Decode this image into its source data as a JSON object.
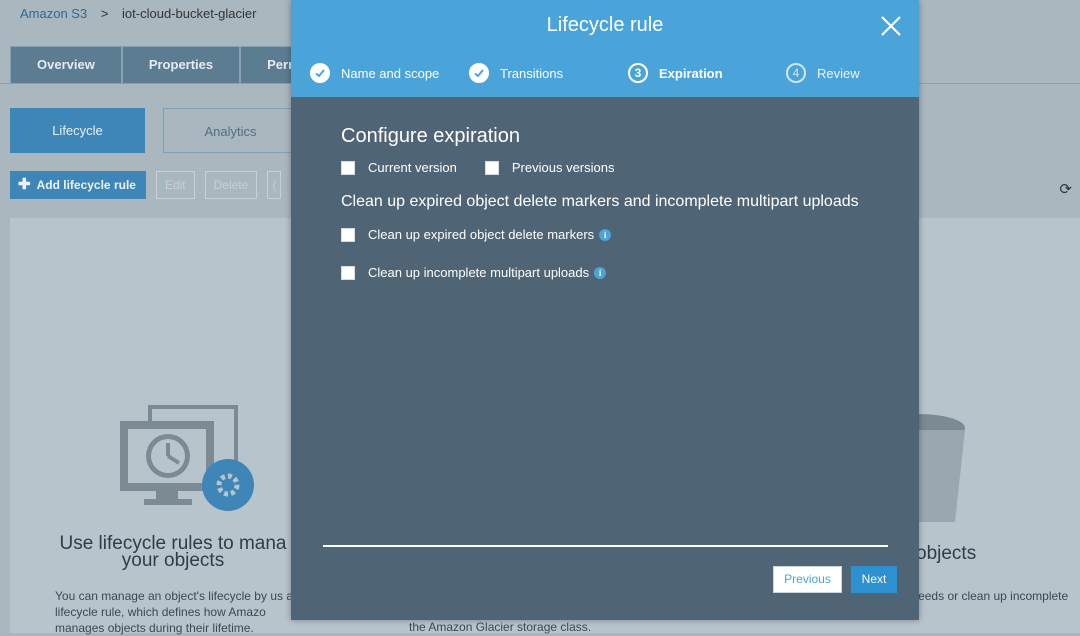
{
  "breadcrumb": {
    "root": "Amazon S3",
    "separator": ">",
    "current": "iot-cloud-bucket-glacier"
  },
  "top_tabs": [
    "Overview",
    "Properties",
    "Perm"
  ],
  "sub_tabs": {
    "active": "Lifecycle",
    "other": "Analytics"
  },
  "actions": {
    "add": "Add lifecycle rule",
    "edit": "Edit",
    "delete": "Delete",
    "more": "("
  },
  "background": {
    "lifecycle_title": "Use lifecycle rules to mana your objects",
    "lifecycle_desc": "You can manage an object's lifecycle by us a lifecycle rule, which defines how Amazo manages objects during their lifetime.",
    "middle_desc": "the Amazon Glacier storage class.",
    "right_title": "objects",
    "right_desc": "an automatically r retention needs or clean up incomplete multipart uploads."
  },
  "modal": {
    "title": "Lifecycle rule",
    "steps": [
      {
        "label": "Name and scope",
        "state": "done"
      },
      {
        "label": "Transitions",
        "state": "done"
      },
      {
        "label": "Expiration",
        "state": "active",
        "number": "3"
      },
      {
        "label": "Review",
        "state": "future",
        "number": "4"
      }
    ],
    "heading": "Configure expiration",
    "current_version": "Current version",
    "previous_versions": "Previous versions",
    "cleanup_heading": "Clean up expired object delete markers and incomplete multipart uploads",
    "cleanup_markers": "Clean up expired object delete markers",
    "cleanup_multipart": "Clean up incomplete multipart uploads",
    "info_glyph": "i",
    "previous_button": "Previous",
    "next_button": "Next"
  },
  "colors": {
    "header": "#4aa3d9",
    "modal_body": "#4f6474",
    "primary_button": "#2e8fd1"
  }
}
